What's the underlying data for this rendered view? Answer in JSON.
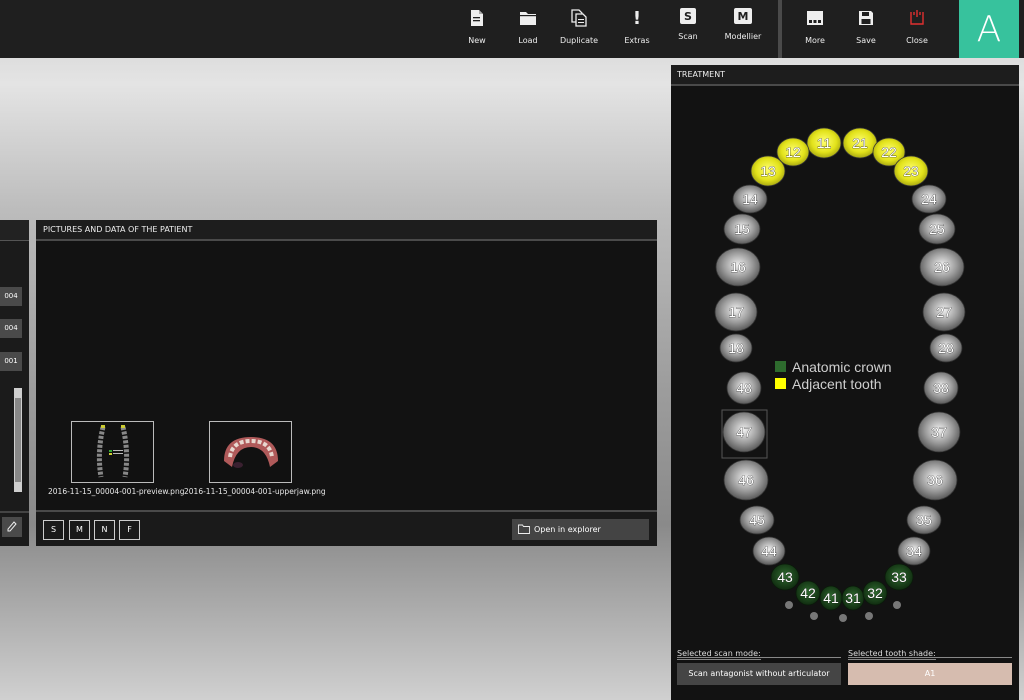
{
  "toolbar": {
    "buttons": [
      {
        "label": "New",
        "icon": "new-document-icon"
      },
      {
        "label": "Load",
        "icon": "folder-icon"
      },
      {
        "label": "Duplicate",
        "icon": "duplicate-icon"
      },
      {
        "label": "Extras",
        "icon": "exclamation-icon"
      },
      {
        "label": "Scan",
        "icon": "scan-s-icon"
      },
      {
        "label": "Modellier",
        "icon": "modellier-m-icon"
      },
      {
        "label": "More",
        "icon": "more-dots-icon"
      },
      {
        "label": "Save",
        "icon": "floppy-disk-icon"
      },
      {
        "label": "Close",
        "icon": "power-icon"
      }
    ],
    "icon_letters": {
      "scan": "S",
      "modellier": "M",
      "extras": "!"
    },
    "close_color": "#e03030",
    "logo_letter": "A",
    "logo_color": "#37c29d"
  },
  "left_panel": {
    "fields": [
      "004",
      "004",
      "001"
    ]
  },
  "pictures_panel": {
    "title": "PICTURES AND DATA OF THE PATIENT",
    "files": [
      {
        "name": "2016-11-15_00004-001-preview.png"
      },
      {
        "name": "2016-11-15_00004-001-upperjaw.png"
      }
    ],
    "mode_buttons": [
      "S",
      "M",
      "N",
      "F"
    ],
    "open_explorer_label": "Open in explorer"
  },
  "treatment_panel": {
    "title": "TREATMENT",
    "legend": [
      {
        "label": "Anatomic crown",
        "color": "#2e6b2e"
      },
      {
        "label": "Adjacent tooth",
        "color": "#ffff00"
      }
    ],
    "adjacent_color": "#e2e21a",
    "crown_color": "#1f4a1f",
    "teeth": [
      {
        "number": "11",
        "state": "adjacent"
      },
      {
        "number": "12",
        "state": "adjacent"
      },
      {
        "number": "13",
        "state": "adjacent"
      },
      {
        "number": "21",
        "state": "adjacent"
      },
      {
        "number": "22",
        "state": "adjacent"
      },
      {
        "number": "23",
        "state": "adjacent"
      },
      {
        "number": "14",
        "state": "normal"
      },
      {
        "number": "15",
        "state": "normal"
      },
      {
        "number": "16",
        "state": "normal"
      },
      {
        "number": "17",
        "state": "normal"
      },
      {
        "number": "18",
        "state": "normal"
      },
      {
        "number": "24",
        "state": "normal"
      },
      {
        "number": "25",
        "state": "normal"
      },
      {
        "number": "26",
        "state": "normal"
      },
      {
        "number": "27",
        "state": "normal"
      },
      {
        "number": "28",
        "state": "normal"
      },
      {
        "number": "48",
        "state": "normal"
      },
      {
        "number": "47",
        "state": "normal"
      },
      {
        "number": "46",
        "state": "normal"
      },
      {
        "number": "45",
        "state": "normal"
      },
      {
        "number": "44",
        "state": "normal"
      },
      {
        "number": "38",
        "state": "normal"
      },
      {
        "number": "37",
        "state": "normal"
      },
      {
        "number": "36",
        "state": "normal"
      },
      {
        "number": "35",
        "state": "normal"
      },
      {
        "number": "34",
        "state": "normal"
      },
      {
        "number": "43",
        "state": "crown"
      },
      {
        "number": "42",
        "state": "crown"
      },
      {
        "number": "41",
        "state": "crown"
      },
      {
        "number": "31",
        "state": "crown"
      },
      {
        "number": "32",
        "state": "crown"
      },
      {
        "number": "33",
        "state": "crown"
      }
    ],
    "selected_scan_mode_label": "Selected scan mode:",
    "selected_scan_mode_value": "Scan antagonist without articulator",
    "selected_tooth_shade_label": "Selected tooth shade:",
    "selected_tooth_shade_value": "A1",
    "shade_color": "#d6bcaf"
  }
}
